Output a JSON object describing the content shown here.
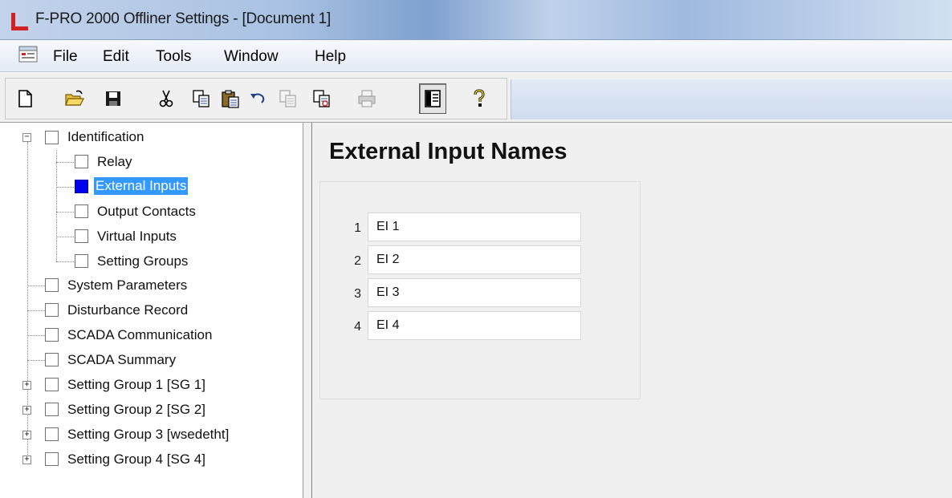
{
  "window": {
    "title": "F-PRO 2000 Offliner Settings - [Document 1]"
  },
  "menu": {
    "items": [
      "File",
      "Edit",
      "Tools",
      "Window",
      "Help"
    ]
  },
  "toolbar": {
    "buttons": [
      "new-icon",
      "open-folder-icon",
      "save-icon",
      "cut-icon",
      "copy-icon",
      "paste-icon",
      "undo-icon",
      "copy-disabled-icon",
      "compare-icon",
      "print-icon",
      "view-panel-icon",
      "help-icon"
    ]
  },
  "tree": {
    "items": [
      {
        "label": "Identification",
        "level": 0,
        "expander": "minus"
      },
      {
        "label": "Relay",
        "level": 1
      },
      {
        "label": "External Inputs",
        "level": 1,
        "selected": true
      },
      {
        "label": "Output Contacts",
        "level": 1
      },
      {
        "label": "Virtual Inputs",
        "level": 1
      },
      {
        "label": "Setting Groups",
        "level": 1
      },
      {
        "label": "System Parameters",
        "level": 0
      },
      {
        "label": "Disturbance Record",
        "level": 0
      },
      {
        "label": "SCADA Communication",
        "level": 0
      },
      {
        "label": "SCADA Summary",
        "level": 0
      },
      {
        "label": "Setting Group 1 [SG 1]",
        "level": 0,
        "expander": "plus"
      },
      {
        "label": "Setting Group 2 [SG 2]",
        "level": 0,
        "expander": "plus"
      },
      {
        "label": "Setting Group 3 [wsedetht]",
        "level": 0,
        "expander": "plus"
      },
      {
        "label": "Setting Group 4 [SG 4]",
        "level": 0,
        "expander": "plus"
      }
    ]
  },
  "main": {
    "title": "External Input Names",
    "inputs": [
      {
        "number": "1",
        "value": "EI 1"
      },
      {
        "number": "2",
        "value": "EI 2"
      },
      {
        "number": "3",
        "value": "EI 3"
      },
      {
        "number": "4",
        "value": "EI 4"
      }
    ]
  },
  "colors": {
    "selection": "#3399ff",
    "selected_checkbox": "#0000ee",
    "app_icon_red": "#d42020"
  }
}
